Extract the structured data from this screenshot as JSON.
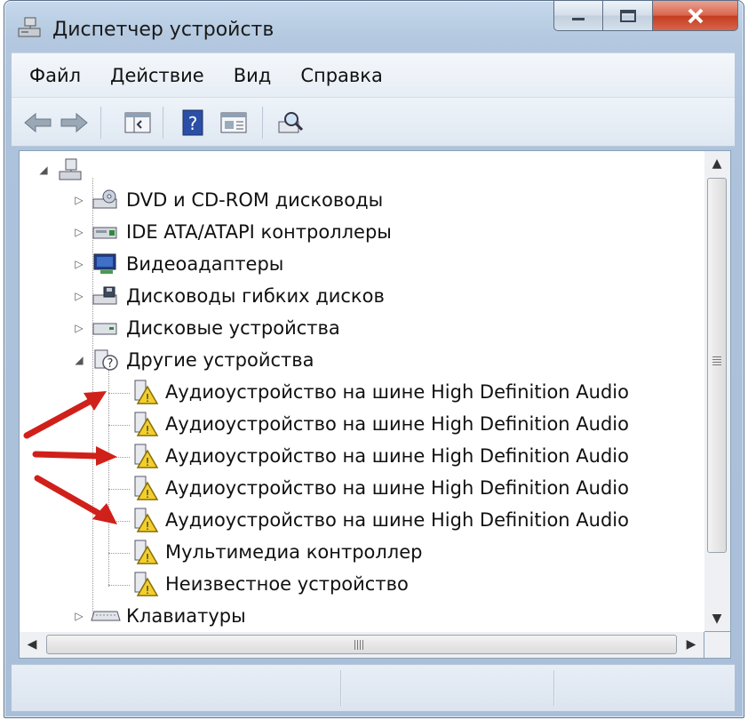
{
  "window": {
    "title": "Диспетчер устройств"
  },
  "menu": [
    "Файл",
    "Действие",
    "Вид",
    "Справка"
  ],
  "toolbar": {
    "icons": [
      "back-arrow-icon",
      "forward-arrow-icon",
      "show-hide-console-tree-icon",
      "help-icon",
      "properties-icon",
      "scan-hardware-icon"
    ]
  },
  "tree": {
    "root_icon": "computer-icon",
    "categories": [
      {
        "label": "DVD и CD-ROM дисководы",
        "icon": "dvd-drive-icon",
        "expanded": false
      },
      {
        "label": "IDE ATA/ATAPI контроллеры",
        "icon": "ide-controller-icon",
        "expanded": false
      },
      {
        "label": "Видеоадаптеры",
        "icon": "display-adapter-icon",
        "expanded": false
      },
      {
        "label": "Дисководы гибких дисков",
        "icon": "floppy-drive-icon",
        "expanded": false
      },
      {
        "label": "Дисковые устройства",
        "icon": "disk-drive-icon",
        "expanded": false
      },
      {
        "label": "Другие устройства",
        "icon": "unknown-device-icon",
        "expanded": true
      },
      {
        "label": "Клавиатуры",
        "icon": "keyboard-icon",
        "expanded": false
      }
    ],
    "other_devices": [
      {
        "label": "Аудиоустройство на шине High Definition Audio",
        "icon": "warning-device-icon",
        "highlighted": true
      },
      {
        "label": "Аудиоустройство на шине High Definition Audio",
        "icon": "warning-device-icon",
        "highlighted": false
      },
      {
        "label": "Аудиоустройство на шине High Definition Audio",
        "icon": "warning-device-icon",
        "highlighted": true
      },
      {
        "label": "Аудиоустройство на шине High Definition Audio",
        "icon": "warning-device-icon",
        "highlighted": false
      },
      {
        "label": "Аудиоустройство на шине High Definition Audio",
        "icon": "warning-device-icon",
        "highlighted": true
      },
      {
        "label": "Мультимедиа контроллер",
        "icon": "warning-device-icon",
        "highlighted": false
      },
      {
        "label": "Неизвестное устройство",
        "icon": "warning-device-icon",
        "highlighted": false
      }
    ]
  },
  "colors": {
    "annotation_arrow": "#d0201a",
    "warning_yellow": "#f2cf2e"
  }
}
